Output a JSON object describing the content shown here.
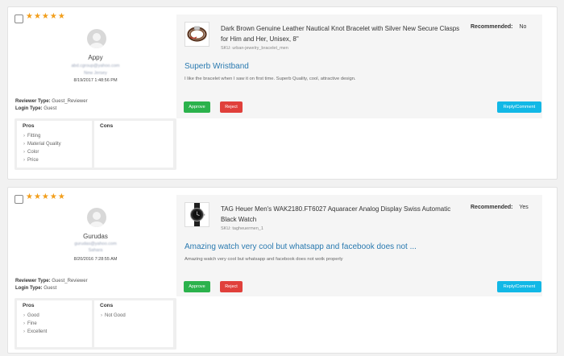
{
  "reviews": [
    {
      "stars": "★★★★★",
      "reviewer_name": "Appy",
      "email": "abd.cgroup@yahoo.com",
      "location": "New Jersey",
      "date": "8/19/2017 1:48:56 PM",
      "reviewer_type_label": "Reviewer Type:",
      "reviewer_type": "Guest_Reviewer",
      "login_type_label": "Login Type:",
      "login_type": "Guest",
      "pros_label": "Pros",
      "cons_label": "Cons",
      "pros": [
        "Fitting",
        "Material Quality",
        "Color",
        "Price"
      ],
      "cons": [],
      "product_title": "Dark Brown Genuine Leather Nautical Knot Bracelet with Silver New Secure Clasps for Him and Her, Unisex, 8\"",
      "sku": "SKU: urban-jewelry_bracelet_men",
      "recommended_label": "Recommended:",
      "recommended_value": "No",
      "review_title": "Superb Wristband",
      "review_text": "I like the bracelet when I saw it on first time. Superb Quality, cool, attractive design.",
      "approve_label": "Approve",
      "reject_label": "Reject",
      "reply_label": "Reply/Comment",
      "thumb_icon": "bracelet-icon"
    },
    {
      "stars": "★★★★★",
      "reviewer_name": "Gurudas",
      "email": "gurudas@yahoo.com",
      "location": "Sahara",
      "date": "8/20/2016 7:28:55 AM",
      "reviewer_type_label": "Reviewer Type:",
      "reviewer_type": "Guest_Reviewer",
      "login_type_label": "Login Type:",
      "login_type": "Guest",
      "pros_label": "Pros",
      "cons_label": "Cons",
      "pros": [
        "Good",
        "Fine",
        "Excellent"
      ],
      "cons": [
        "Not Good"
      ],
      "product_title": "TAG Heuer Men's WAK2180.FT6027 Aquaracer Analog Display Swiss Automatic Black Watch",
      "sku": "SKU: tagheuermen_1",
      "recommended_label": "Recommended:",
      "recommended_value": "Yes",
      "review_title": "Amazing watch very cool but whatsapp and facebook does not ...",
      "review_text": "Amazing watch very cool but whatsapp and facebook does not wotk properly",
      "approve_label": "Approve",
      "reject_label": "Reject",
      "reply_label": "Reply/Comment",
      "thumb_icon": "watch-icon"
    }
  ],
  "colors": {
    "star": "#f29e1b",
    "approve": "#2bb24c",
    "reject": "#e0403b",
    "reply": "#12b8e6",
    "review_title": "#2a7ab0"
  }
}
